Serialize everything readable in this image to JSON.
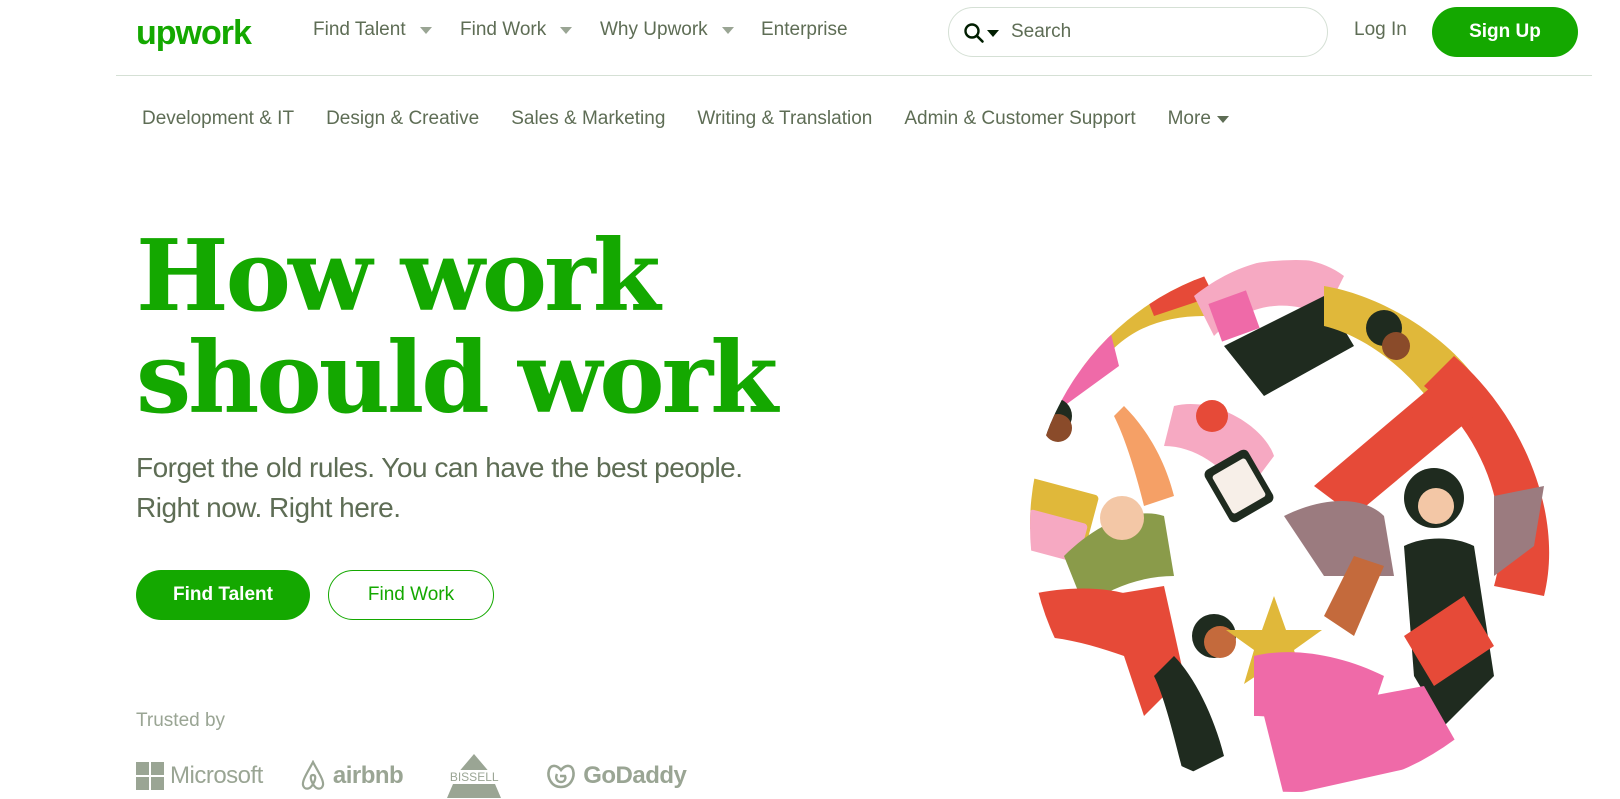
{
  "brand": {
    "name": "upwork",
    "accent": "#14a800",
    "text_gray": "#5e6d55"
  },
  "topnav": {
    "items": [
      {
        "label": "Find Talent",
        "dropdown": true
      },
      {
        "label": "Find Work",
        "dropdown": true
      },
      {
        "label": "Why Upwork",
        "dropdown": true
      },
      {
        "label": "Enterprise",
        "dropdown": false
      }
    ],
    "search": {
      "placeholder": "Search",
      "icon": "search-icon"
    },
    "login": "Log In",
    "signup": "Sign Up"
  },
  "categories": {
    "items": [
      "Development & IT",
      "Design & Creative",
      "Sales & Marketing",
      "Writing & Translation",
      "Admin & Customer Support"
    ],
    "more": "More"
  },
  "hero": {
    "title_line1": "How work",
    "title_line2": "should work",
    "subtitle_line1": "Forget the old rules. You can have the best people.",
    "subtitle_line2": "Right now. Right here.",
    "primary_button": "Find Talent",
    "secondary_button": "Find Work"
  },
  "trusted": {
    "label": "Trusted by",
    "logos": [
      "Microsoft",
      "airbnb",
      "BISSELL",
      "GoDaddy"
    ]
  }
}
